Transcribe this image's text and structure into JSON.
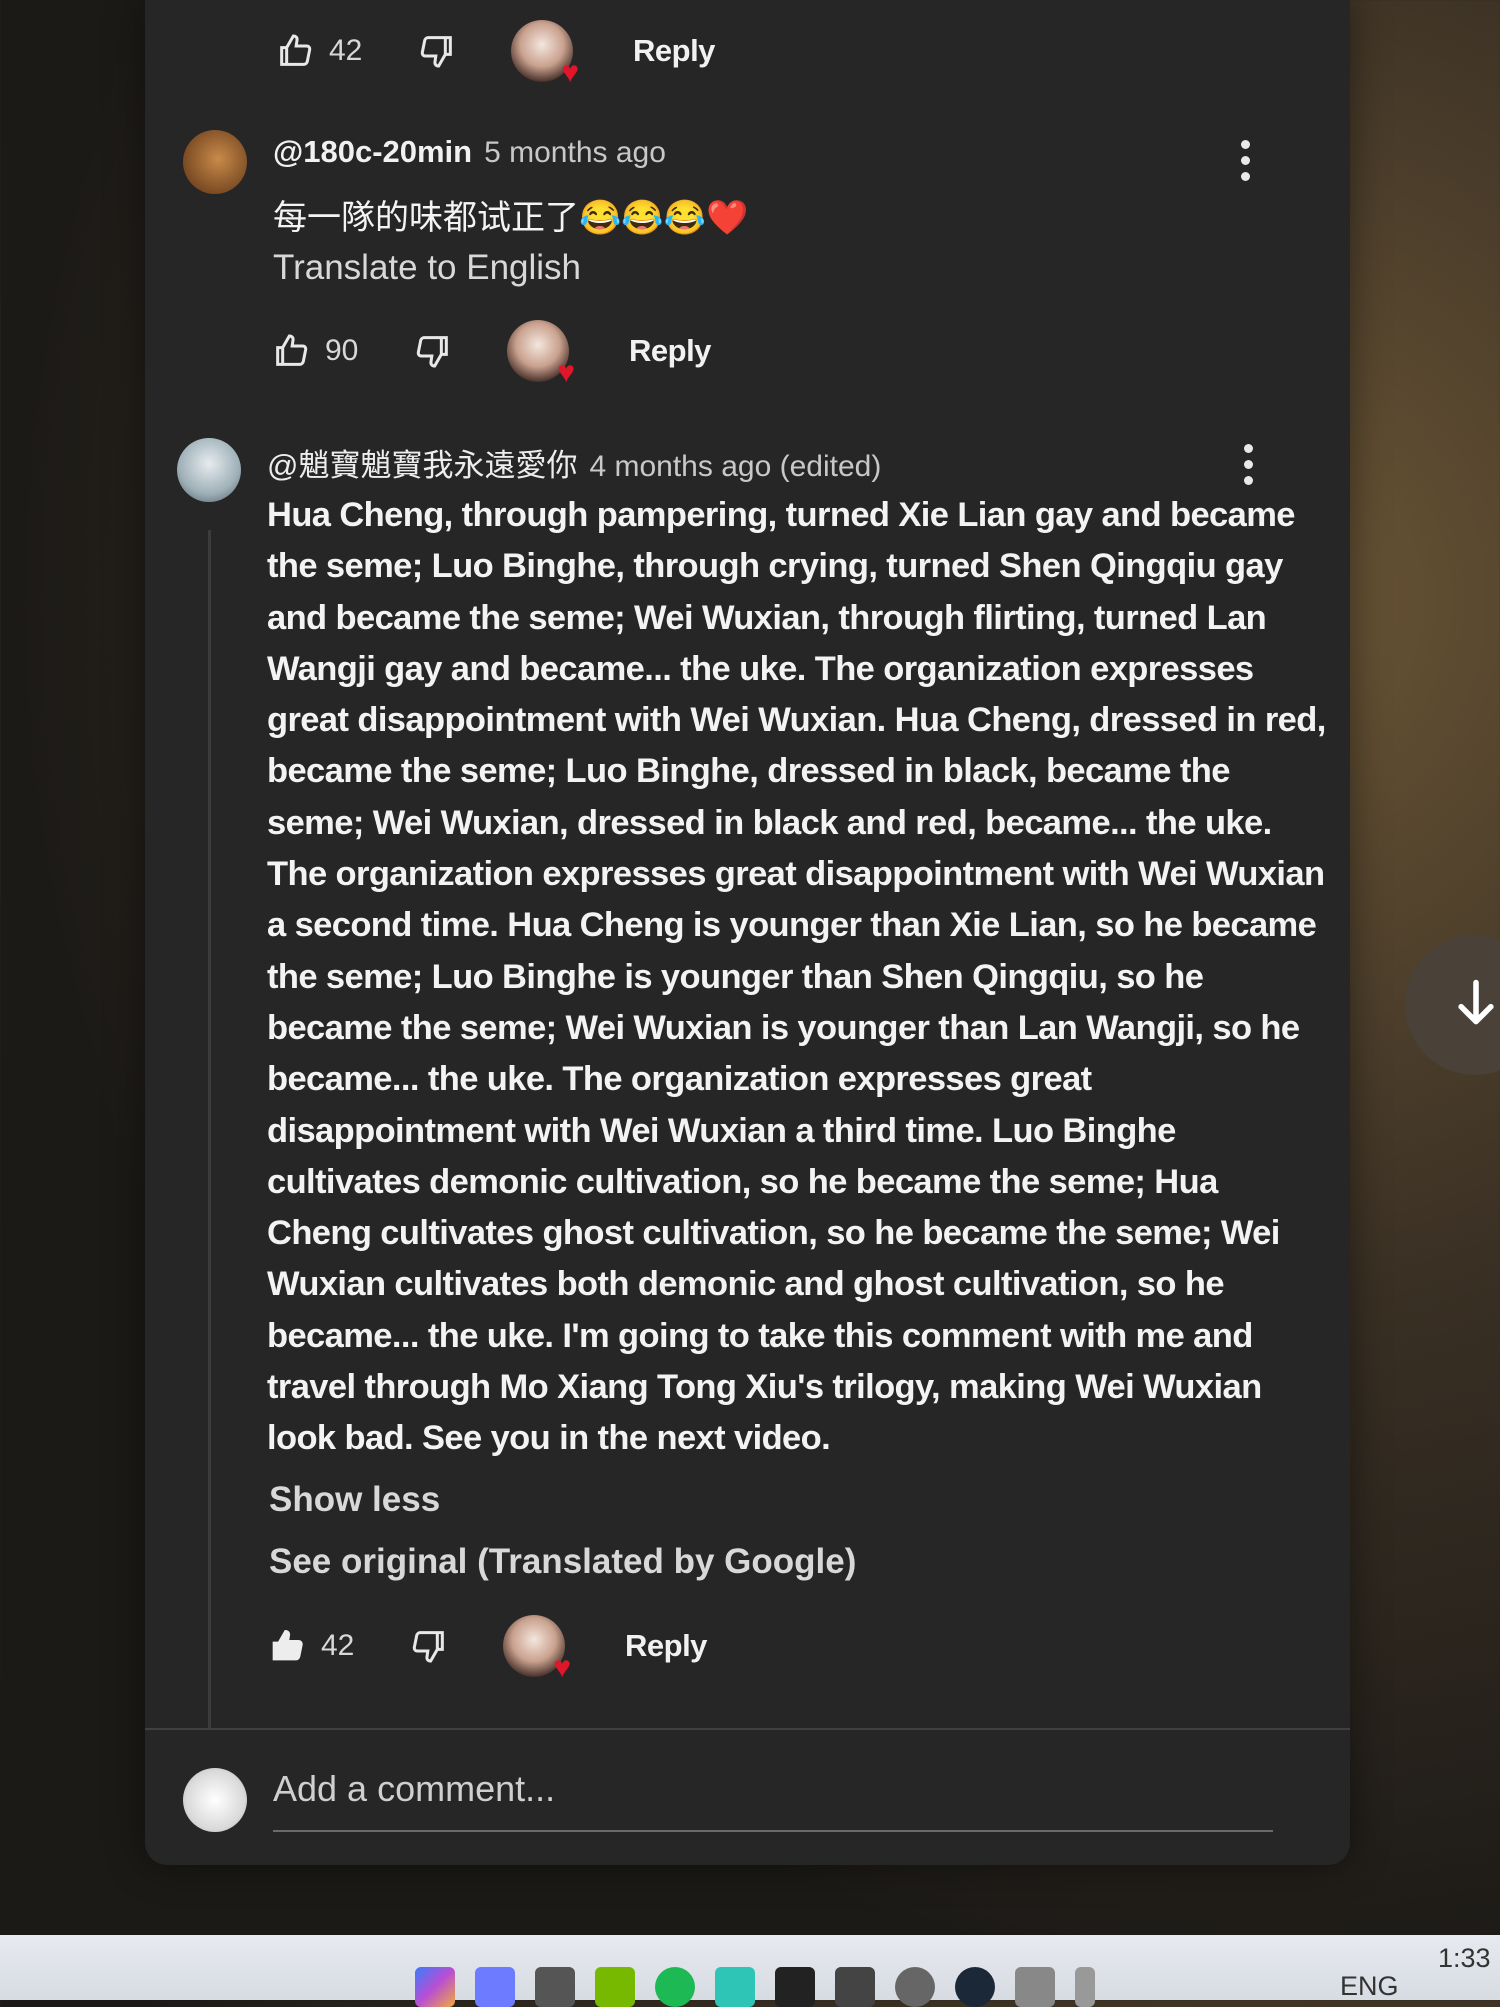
{
  "comments": [
    {
      "likes": "42",
      "reply_label": "Reply"
    },
    {
      "author": "@180c-20min",
      "time": "5 months ago",
      "text": "每一隊的味都试正了😂😂😂❤️",
      "translate_link": "Translate to English",
      "likes": "90",
      "reply_label": "Reply"
    },
    {
      "author": "@魈寶魈寶我永遠愛你",
      "time": "4 months ago (edited)",
      "text": "Hua Cheng, through pampering, turned Xie Lian gay and became the seme; Luo Binghe, through crying, turned Shen Qingqiu gay and became the seme; Wei Wuxian, through flirting, turned Lan Wangji gay and became... the uke. The organization expresses great disappointment with Wei Wuxian. Hua Cheng, dressed in red, became the seme; Luo Binghe, dressed in black, became the seme; Wei Wuxian, dressed in black and red, became... the uke. The organization expresses great disappointment with Wei Wuxian a second time. Hua Cheng is younger than Xie Lian, so he became the seme; Luo Binghe is younger than Shen Qingqiu, so he became the seme; Wei Wuxian is younger than Lan Wangji, so he became... the uke. The organization expresses great disappointment with Wei Wuxian a third time. Luo Binghe cultivates demonic cultivation, so he became the seme; Hua Cheng cultivates ghost cultivation, so he became the seme; Wei Wuxian cultivates both demonic and ghost cultivation, so he became... the uke. I'm going to take this comment with me and travel through Mo Xiang Tong Xiu's trilogy, making Wei Wuxian look bad. See you in the next video.",
      "show_less": "Show less",
      "see_original": "See original (Translated by Google)",
      "likes": "42",
      "reply_label": "Reply"
    }
  ],
  "add_comment_placeholder": "Add a comment...",
  "taskbar": {
    "language": "ENG",
    "time": "1:33"
  },
  "colors": {
    "panel_bg": "#262626",
    "heart": "#e0162b"
  },
  "icons": [
    "thumbs-up-icon",
    "thumbs-down-icon",
    "kebab-menu-icon",
    "arrow-down-icon"
  ]
}
